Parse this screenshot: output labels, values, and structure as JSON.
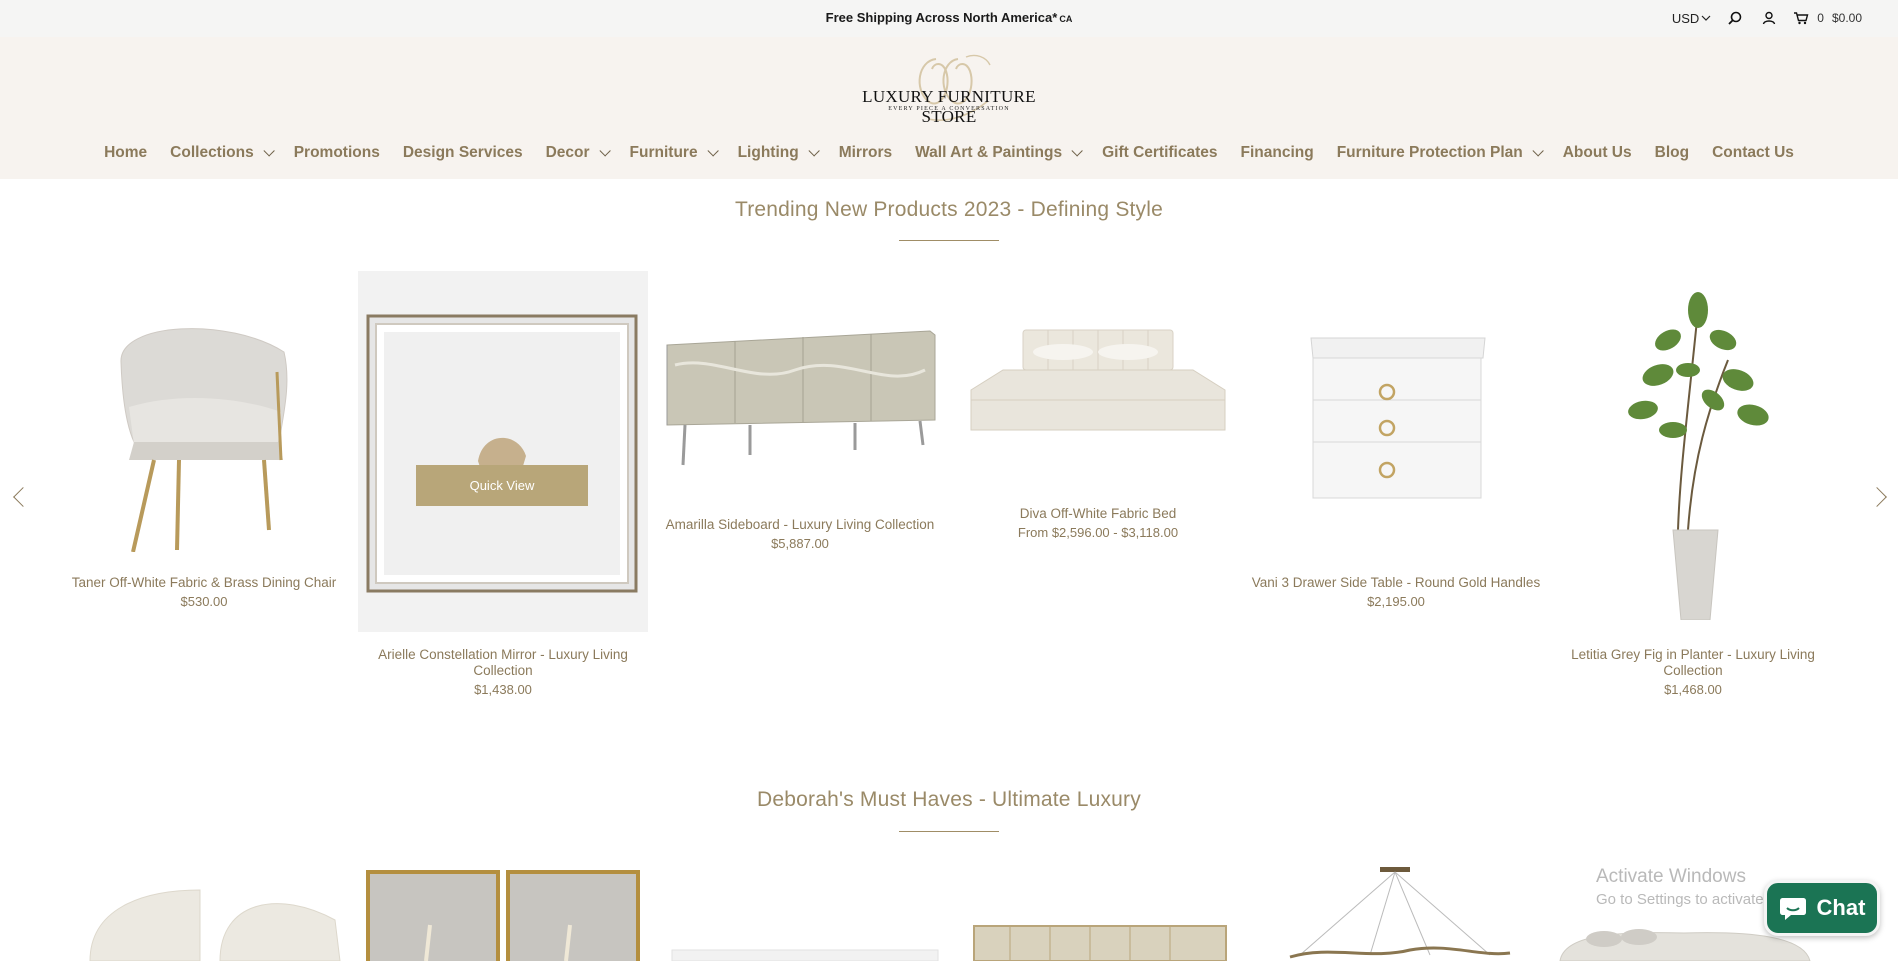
{
  "topbar": {
    "promo": "Free Shipping Across North America*",
    "promo_suffix": "CA",
    "currency": "USD",
    "cart_count": "0",
    "cart_total": "$0.00"
  },
  "logo": {
    "name": "LUXURY FURNITURE STORE",
    "tagline": "EVERY PIECE A CONVERSATION"
  },
  "nav": [
    {
      "label": "Home",
      "dropdown": false
    },
    {
      "label": "Collections",
      "dropdown": true
    },
    {
      "label": "Promotions",
      "dropdown": false
    },
    {
      "label": "Design Services",
      "dropdown": false
    },
    {
      "label": "Decor",
      "dropdown": true
    },
    {
      "label": "Furniture",
      "dropdown": true
    },
    {
      "label": "Lighting",
      "dropdown": true
    },
    {
      "label": "Mirrors",
      "dropdown": false
    },
    {
      "label": "Wall Art & Paintings",
      "dropdown": true
    },
    {
      "label": "Gift Certificates",
      "dropdown": false
    },
    {
      "label": "Financing",
      "dropdown": false
    },
    {
      "label": "Furniture Protection Plan",
      "dropdown": true
    },
    {
      "label": "About Us",
      "dropdown": false
    },
    {
      "label": "Blog",
      "dropdown": false
    },
    {
      "label": "Contact Us",
      "dropdown": false
    }
  ],
  "sections": {
    "trending_title": "Trending New Products 2023 - Defining Style",
    "must_haves_title": "Deborah's Must Haves - Ultimate Luxury"
  },
  "trending_products": [
    {
      "title": "Taner Off-White Fabric & Brass Dining Chair",
      "price": "$530.00"
    },
    {
      "title": "Arielle Constellation Mirror - Luxury Living Collection",
      "price": "$1,438.00"
    },
    {
      "title": "Amarilla Sideboard - Luxury Living Collection",
      "price": "$5,887.00"
    },
    {
      "title": "Diva Off-White Fabric Bed",
      "price": "From $2,596.00 - $3,118.00"
    },
    {
      "title": "Vani 3 Drawer Side Table - Round Gold Handles",
      "price": "$2,195.00"
    },
    {
      "title": "Letitia Grey Fig in Planter - Luxury Living Collection",
      "price": "$1,468.00"
    }
  ],
  "quick_view_label": "Quick View",
  "watermark": {
    "line1": "Activate Windows",
    "line2": "Go to Settings to activate Windows."
  },
  "chat_label": "Chat",
  "colors": {
    "accent": "#b8a679",
    "nav_text": "#8b7a5b",
    "header_bg": "#f7f3ef",
    "chat_bg": "#1b7454"
  }
}
